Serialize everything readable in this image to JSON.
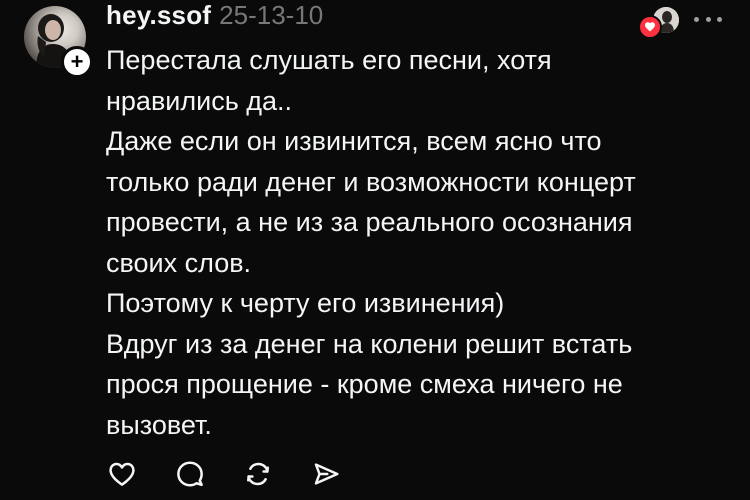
{
  "post": {
    "username": "hey.ssof",
    "date": "25-13-10",
    "follow_glyph": "+",
    "avatar_icon": "user-avatar-photo",
    "reactors": {
      "icons": [
        "heart-icon",
        "reactor-avatar"
      ],
      "heart_color": "#ff3040"
    },
    "more_icon": "more-horizontal-icon",
    "paragraphs": [
      "Перестала слушать его песни, хотя\nнравились да..",
      "Даже если он извинится, всем ясно что\nтолько ради денег и возможности концерт\nпровести, а не из за реального осознания\nсвоих слов.",
      "Поэтому к черту его извинения)",
      "Вдруг из за денег на колени решит встать\nпрося прощение - кроме смеха ничего не\nвызовет."
    ],
    "actions": [
      {
        "name": "like-button",
        "icon": "heart-outline-icon"
      },
      {
        "name": "comment-button",
        "icon": "speech-bubble-icon"
      },
      {
        "name": "repost-button",
        "icon": "repost-icon"
      },
      {
        "name": "share-button",
        "icon": "send-icon"
      }
    ]
  },
  "colors": {
    "background": "#0a0a0a",
    "text_primary": "#f3f5f7",
    "text_secondary": "#777777",
    "heart": "#ff3040"
  }
}
